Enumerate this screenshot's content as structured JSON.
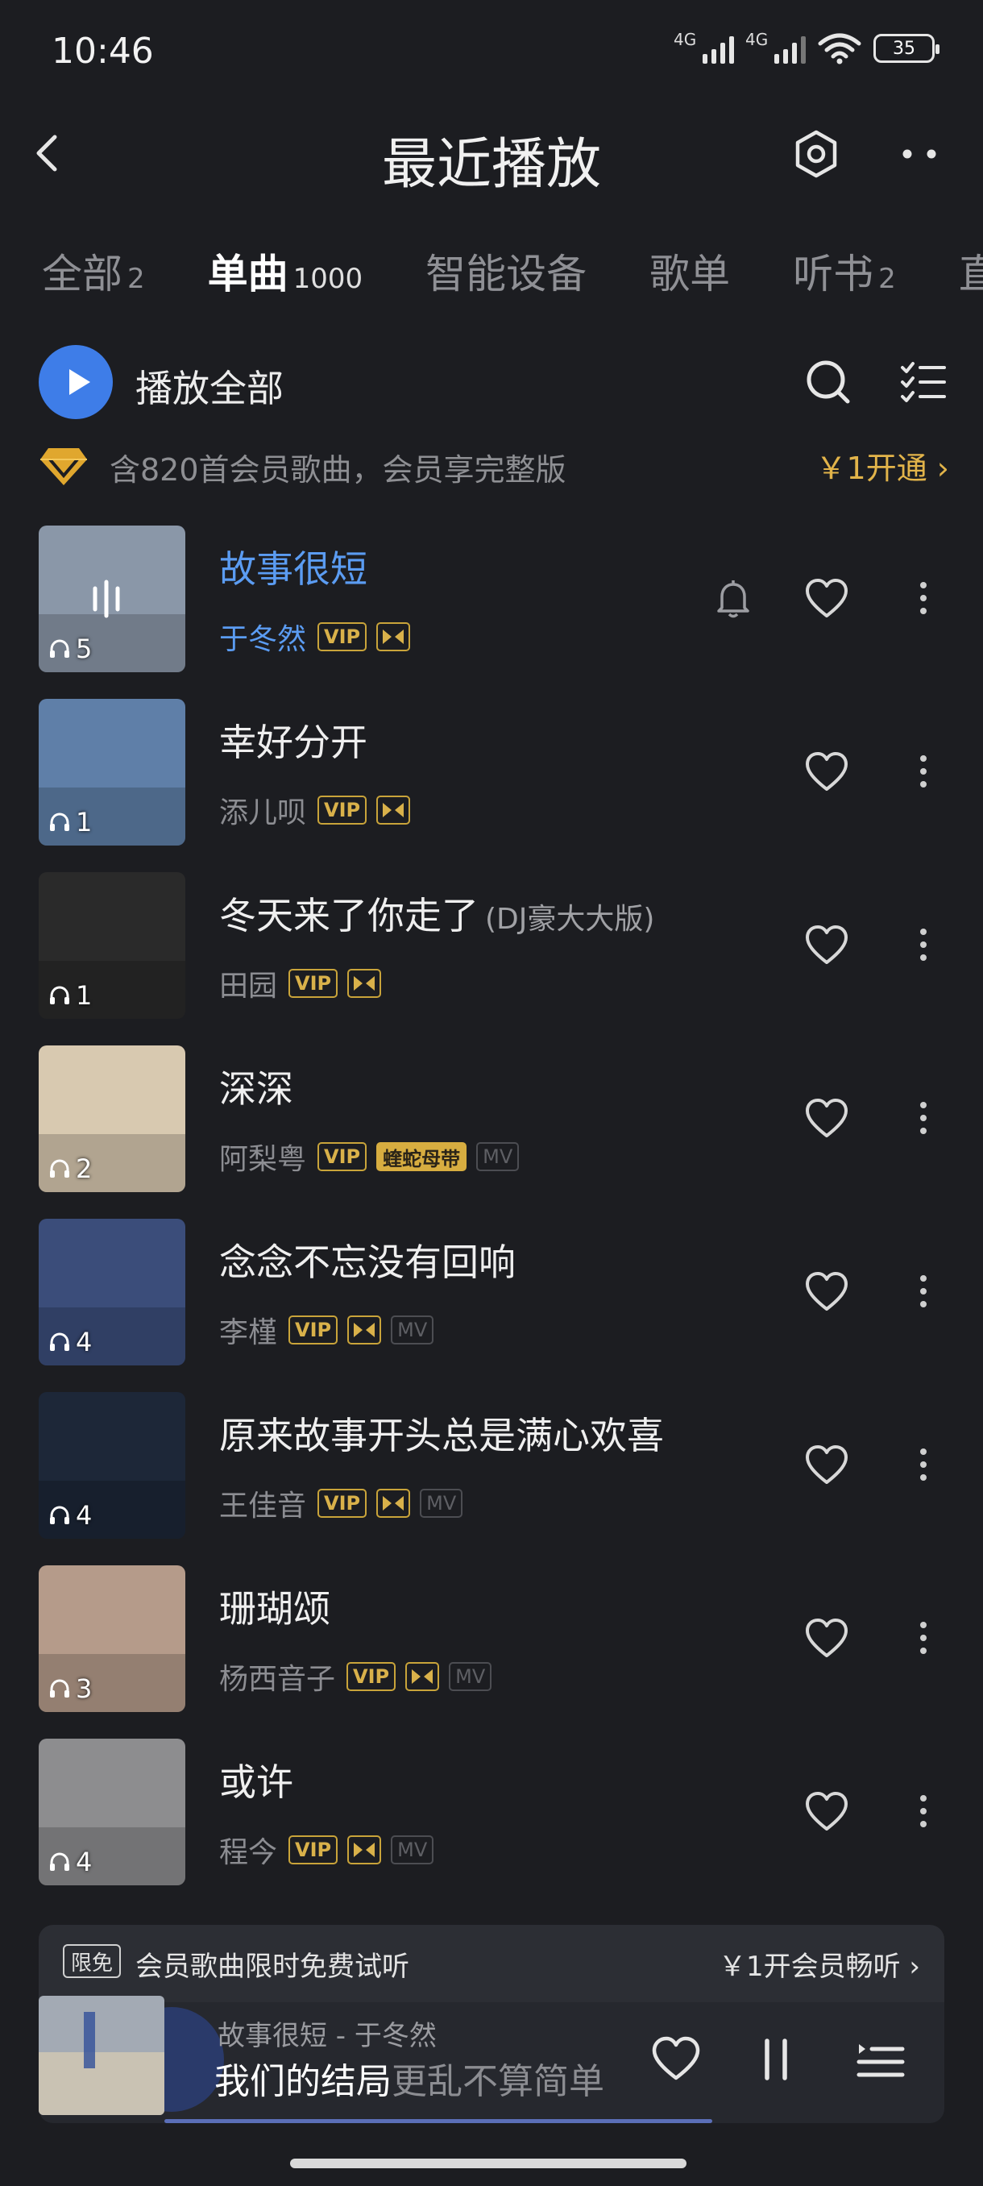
{
  "status_bar": {
    "time": "10:46",
    "net1": "4G",
    "net2": "4G",
    "battery": "35"
  },
  "header": {
    "title": "最近播放"
  },
  "tabs": [
    {
      "label": "全部",
      "count": "2"
    },
    {
      "label": "单曲",
      "count": "1000"
    },
    {
      "label": "智能设备",
      "count": ""
    },
    {
      "label": "歌单",
      "count": ""
    },
    {
      "label": "听书",
      "count": "2"
    },
    {
      "label": "直",
      "count": ""
    }
  ],
  "play_all": {
    "label": "播放全部"
  },
  "vip_banner": {
    "text": "含820首会员歌曲，会员享完整版",
    "cta": "￥1开通 ›"
  },
  "songs": [
    {
      "title": "故事很短",
      "version": "",
      "artist": "于冬然",
      "plays": "5",
      "badges": [
        "VIP",
        "hq"
      ],
      "playing": true,
      "cover": "#8a97a8"
    },
    {
      "title": "幸好分开",
      "version": "",
      "artist": "添儿呗",
      "plays": "1",
      "badges": [
        "VIP",
        "hq"
      ],
      "playing": false,
      "cover": "#5f7fa8"
    },
    {
      "title": "冬天来了你走了",
      "version": "(DJ豪大大版)",
      "artist": "田园",
      "plays": "1",
      "badges": [
        "VIP",
        "hq"
      ],
      "playing": false,
      "cover": "#2a2a2a"
    },
    {
      "title": "深深",
      "version": "",
      "artist": "阿梨粤",
      "plays": "2",
      "badges": [
        "VIP",
        "蝰蛇母带",
        "MV"
      ],
      "playing": false,
      "cover": "#d8c9b0"
    },
    {
      "title": "念念不忘没有回响",
      "version": "",
      "artist": "李槿",
      "plays": "4",
      "badges": [
        "VIP",
        "hq",
        "MV"
      ],
      "playing": false,
      "cover": "#3b4d7a"
    },
    {
      "title": "原来故事开头总是满心欢喜",
      "version": "",
      "artist": "王佳音",
      "plays": "4",
      "badges": [
        "VIP",
        "hq",
        "MV"
      ],
      "playing": false,
      "cover": "#1d2738"
    },
    {
      "title": "珊瑚颂",
      "version": "",
      "artist": "杨西音子",
      "plays": "3",
      "badges": [
        "VIP",
        "hq",
        "MV"
      ],
      "playing": false,
      "cover": "#b59b8a"
    },
    {
      "title": "或许",
      "version": "",
      "artist": "程今",
      "plays": "4",
      "badges": [
        "VIP",
        "hq",
        "MV"
      ],
      "playing": false,
      "cover": "#8d8d8f"
    }
  ],
  "trial_bar": {
    "tag": "限免",
    "message": "会员歌曲限时免费试听",
    "cta": "￥1开会员畅听 ›"
  },
  "mini_player": {
    "track": "故事很短  -  于冬然",
    "lyric_sung": "我们的结局",
    "lyric_rest": "更乱不算简单"
  },
  "colors": {
    "accent": "#3e7de8",
    "playing_text": "#5b9cf2",
    "vip_gold": "#d9b14a",
    "background": "#1c1d21"
  }
}
